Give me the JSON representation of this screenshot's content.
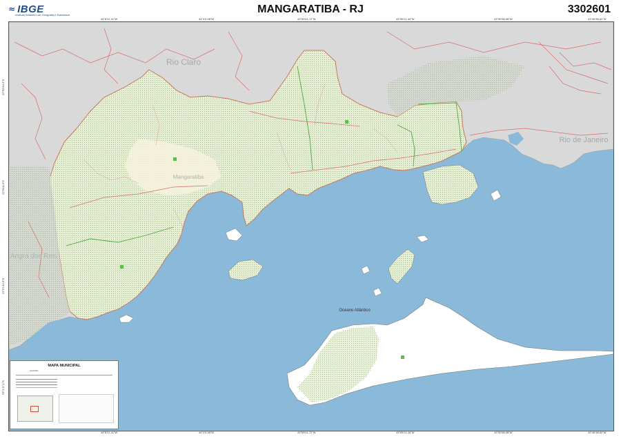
{
  "header": {
    "logo_mark": "≈",
    "logo_text": "IBGE",
    "logo_subtitle": "Instituto Brasileiro de Geografia e Estatística",
    "title": "MANGARATIBA - RJ",
    "code": "3302601"
  },
  "coordinates": {
    "top": [
      "44°8'22,41\"W",
      "44°4'0,98\"W",
      "43°59'41,72\"W",
      "43°55'21,34\"W",
      "43°50'58,08\"W",
      "43°46'38,62\"W"
    ],
    "bottom": [
      "44°8'22,41\"W",
      "44°4'0,98\"W",
      "43°59'41,72\"W",
      "43°55'21,34\"W",
      "43°50'58,08\"W",
      "43°46'38,62\"W"
    ],
    "left": [
      "22°50'34,3\"S",
      "22°54'8,6\"S",
      "22°57'42,9\"S",
      "23°1'17,1\"S"
    ],
    "right": [
      "22°50'34,3\"S",
      "22°54'8,6\"S",
      "22°57'42,9\"S",
      "23°1'17,1\"S"
    ]
  },
  "map_labels": {
    "rio_claro": "Rio Claro",
    "rio_de_janeiro": "Rio de Janeiro",
    "mangaratiba": "Mangaratiba",
    "angra": "Angra dos Reis",
    "ocean": "Oceano Atlântico"
  },
  "legend": {
    "title": "MAPA MUNICIPAL",
    "section": "LEGENDA"
  },
  "colors": {
    "water": "#8ab9d9",
    "land_outside": "#d9d9d9",
    "municipality": "#eef3e2",
    "forest": "#cfe0b0",
    "boundary": "#c87a5a",
    "roads": "#d86a6a",
    "green_line": "#4aa83a"
  }
}
